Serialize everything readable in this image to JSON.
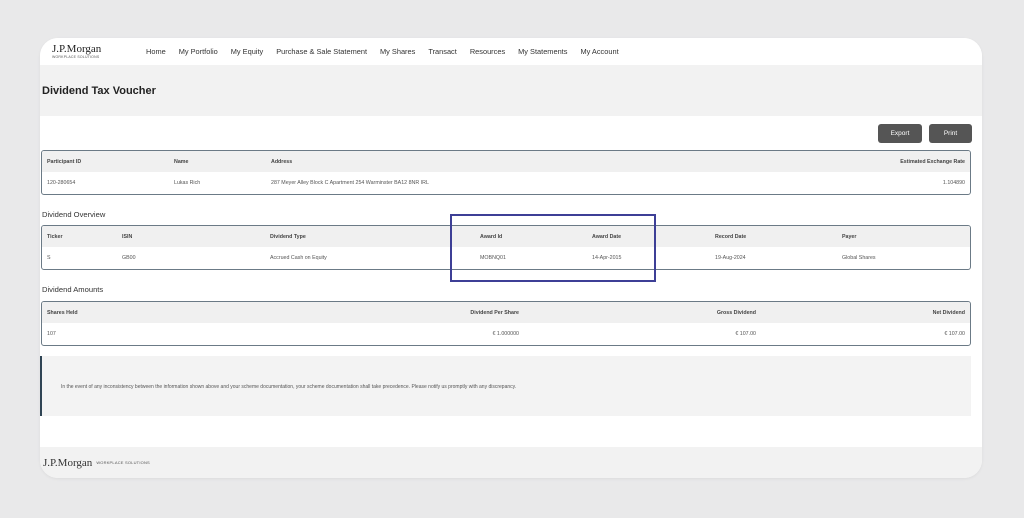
{
  "brand": {
    "name": "J.P.Morgan",
    "tagline": "WORKPLACE SOLUTIONS"
  },
  "nav": [
    "Home",
    "My Portfolio",
    "My Equity",
    "Purchase & Sale Statement",
    "My Shares",
    "Transact",
    "Resources",
    "My Statements",
    "My Account"
  ],
  "page": {
    "title": "Dividend Tax Voucher"
  },
  "actions": {
    "export_label": "Export",
    "print_label": "Print"
  },
  "participant": {
    "headers": [
      "Participant ID",
      "Name",
      "Address",
      "Estimated Exchange Rate"
    ],
    "row": [
      "120-280654",
      "Lukas Rich",
      "287 Meyer Alley Block C Apartment 254 Warminster BA12 8NR IRL",
      "1.104890"
    ]
  },
  "overview": {
    "title": "Dividend Overview",
    "headers": [
      "Ticker",
      "ISIN",
      "Dividend Type",
      "Award Id",
      "Award Date",
      "Record Date",
      "Payer"
    ],
    "row": [
      "S",
      "GB00",
      "Accrued Cash on Equity",
      "MOBNQ01",
      "14-Apr-2015",
      "19-Aug-2024",
      "Global Shares"
    ]
  },
  "amounts": {
    "title": "Dividend Amounts",
    "headers": [
      "Shares Held",
      "Dividend Per Share",
      "Gross Dividend",
      "Net Dividend"
    ],
    "row": [
      "107",
      "€ 1.000000",
      "€ 107.00",
      "€ 107.00"
    ]
  },
  "notice": {
    "text": "In the event of any inconsistency between the information shown above and your scheme documentation, your scheme documentation shall take precedence. Please notify us promptly with any discrepancy."
  },
  "footer": {
    "brand": "J.P.Morgan",
    "tagline": "WORKPLACE SOLUTIONS"
  },
  "colors": {
    "highlight": "#3d3f96",
    "button": "#555555",
    "panel_border": "#6b7a86"
  }
}
